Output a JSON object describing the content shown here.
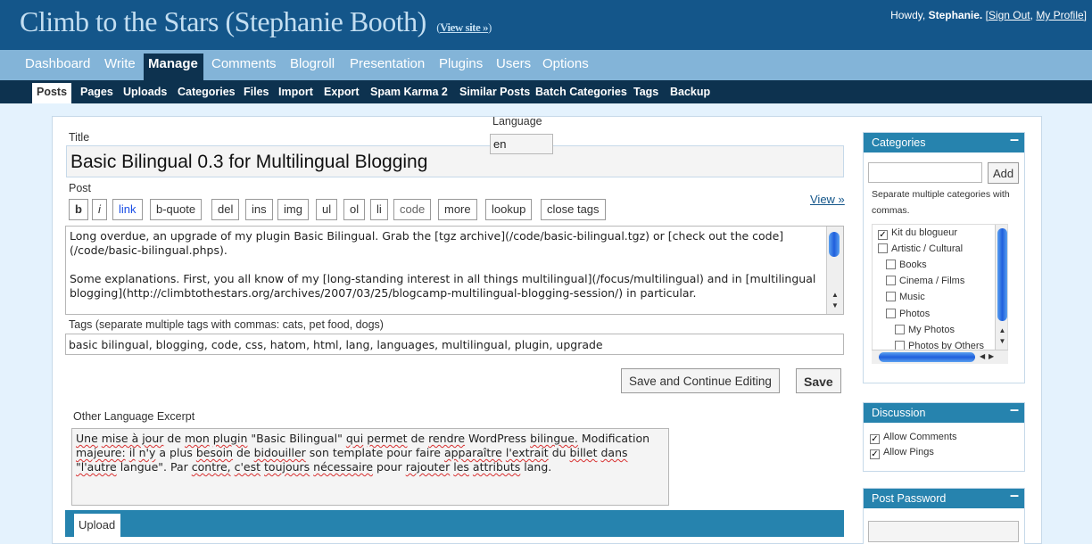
{
  "header": {
    "site_title": "Climb to the Stars (Stephanie Booth)",
    "view_site_open": "(",
    "view_site": "View site »",
    "view_site_close": ")",
    "howdy": "Howdy, ",
    "user": "Stephanie.",
    "bracket_open": "[",
    "sign_out": "Sign Out",
    "comma": ", ",
    "my_profile": "My Profile",
    "bracket_close": "]"
  },
  "menu": [
    "Dashboard",
    "Write",
    "Manage",
    "Comments",
    "Blogroll",
    "Presentation",
    "Plugins",
    "Users",
    "Options"
  ],
  "submenu": [
    "Posts",
    "Pages",
    "Uploads",
    "Categories",
    "Files",
    "Import",
    "Export",
    "Spam Karma 2",
    "Similar Posts",
    "Batch Categories",
    "Tags",
    "Backup"
  ],
  "editor": {
    "title_label": "Title",
    "title_value": "Basic Bilingual 0.3 for Multilingual Blogging",
    "language_label": "Language",
    "language_value": "en",
    "post_label": "Post",
    "view_link": "View »",
    "quicktags": [
      "b",
      "i",
      "link",
      "b-quote",
      "del",
      "ins",
      "img",
      "ul",
      "ol",
      "li",
      "code",
      "more",
      "lookup",
      "close tags"
    ],
    "post_p1": "Long overdue, an upgrade of my plugin Basic Bilingual. Grab the [tgz archive](/code/basic-bilingual.tgz) or [check out the code](/code/basic-bilingual.phps).",
    "post_p2": "Some explanations. First, you all know of my [long-standing interest in all things multilingual](/focus/multilingual) and in [multilingual blogging](http://climbtothestars.org/archives/2007/03/25/blogcamp-multilingual-blogging-session/) in particular.",
    "tags_label": "Tags (separate multiple tags with commas: cats, pet food, dogs)",
    "tags_value": "basic bilingual, blogging, code, css, hatom, html, lang, languages, multilingual, plugin, upgrade",
    "save_continue": "Save and Continue Editing",
    "save": "Save",
    "excerpt_label": "Other Language Excerpt",
    "upload_tab": "Upload"
  },
  "excerpt_words": [
    "Une",
    "mise à jour",
    "de",
    "mon",
    "plugin",
    "\"Basic Bilingual\"",
    "qui",
    "permet",
    "de",
    "rendre",
    "WordPress",
    "bilingue.",
    "Modification",
    "majeure:",
    "il",
    "n'y",
    "a plus",
    "besoin",
    "de",
    "bidouiller",
    "son template pour faire",
    "apparaître",
    "l'extrait",
    "du",
    "billet",
    "dans",
    "\"l'autre",
    "langue\". Par",
    "contre,",
    "c'est",
    "toujours",
    "nécessaire",
    "pour",
    "rajouter",
    "les",
    "attributs",
    "lang."
  ],
  "sidebar": {
    "categories_title": "Categories",
    "toggle": "–",
    "add_button": "Add",
    "cat_help": "Separate multiple categories with commas.",
    "categories": [
      {
        "name": "Kit du blogueur",
        "checked": true
      },
      {
        "name": "Artistic / Cultural",
        "checked": false
      },
      {
        "name": "Books",
        "checked": false
      },
      {
        "name": "Cinema / Films",
        "checked": false
      },
      {
        "name": "Music",
        "checked": false
      },
      {
        "name": "Photos",
        "checked": false
      },
      {
        "name": "My Photos",
        "checked": false
      },
      {
        "name": "Photos by Others",
        "checked": false
      }
    ],
    "discussion_title": "Discussion",
    "allow_comments": "Allow Comments",
    "allow_pings": "Allow Pings",
    "password_title": "Post Password"
  },
  "colors": {
    "header_bg": "#14568a",
    "menu_bg": "#83b4d8",
    "submenu_bg": "#0d324f",
    "box_head_bg": "#2683ae",
    "page_bg": "#e4f2fd"
  }
}
